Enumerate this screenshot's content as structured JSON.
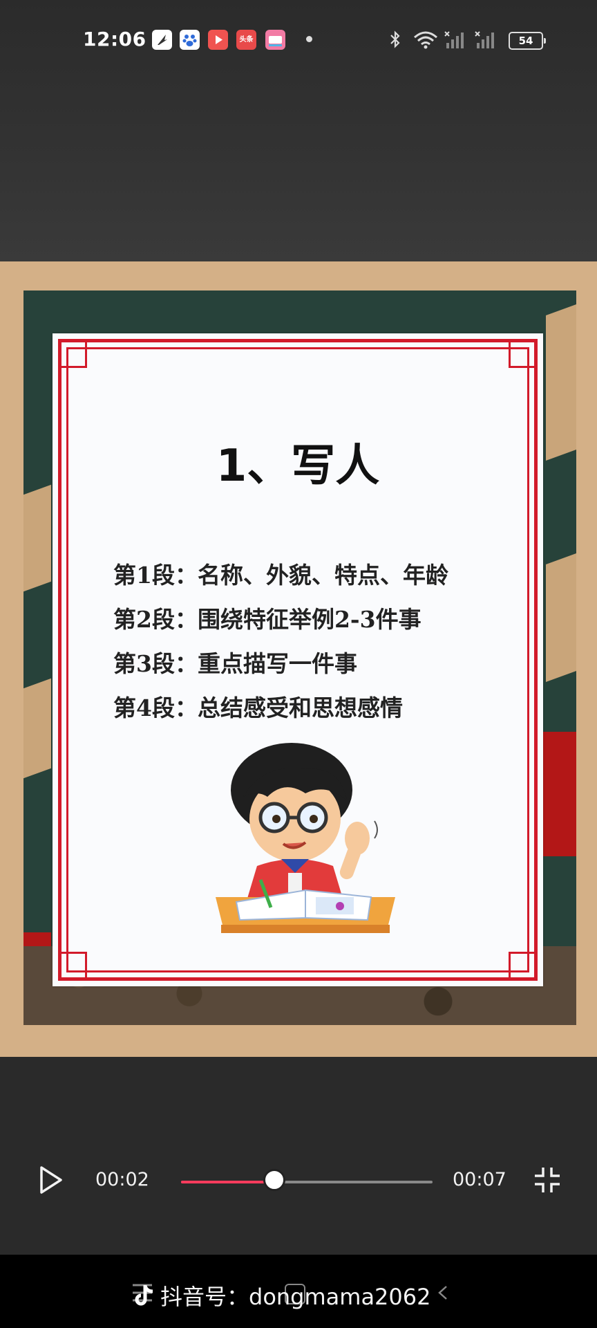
{
  "status_bar": {
    "time": "12:06",
    "notification_apps": [
      "feather-app-icon",
      "baidu-app-icon",
      "video-play-app-icon",
      "toutiao-app-icon",
      "iqiyi-app-icon"
    ],
    "toutiao_label": "头条",
    "battery": "54"
  },
  "card": {
    "title": "1、写人",
    "paragraphs": [
      "第1段：名称、外貌、特点、年龄",
      "第2段：围绕特征举例2-3件事",
      "第3段：重点描写一件事",
      "第4段：总结感受和思想感情"
    ]
  },
  "player": {
    "current_time": "00:02",
    "total_time": "00:07",
    "progress": 0.37,
    "accent_color": "#ff3b5c"
  },
  "watermark": {
    "text": "抖音号：dongmama2062"
  },
  "colors": {
    "card_border": "#d21a2a",
    "frame_bg": "#d4b087"
  }
}
